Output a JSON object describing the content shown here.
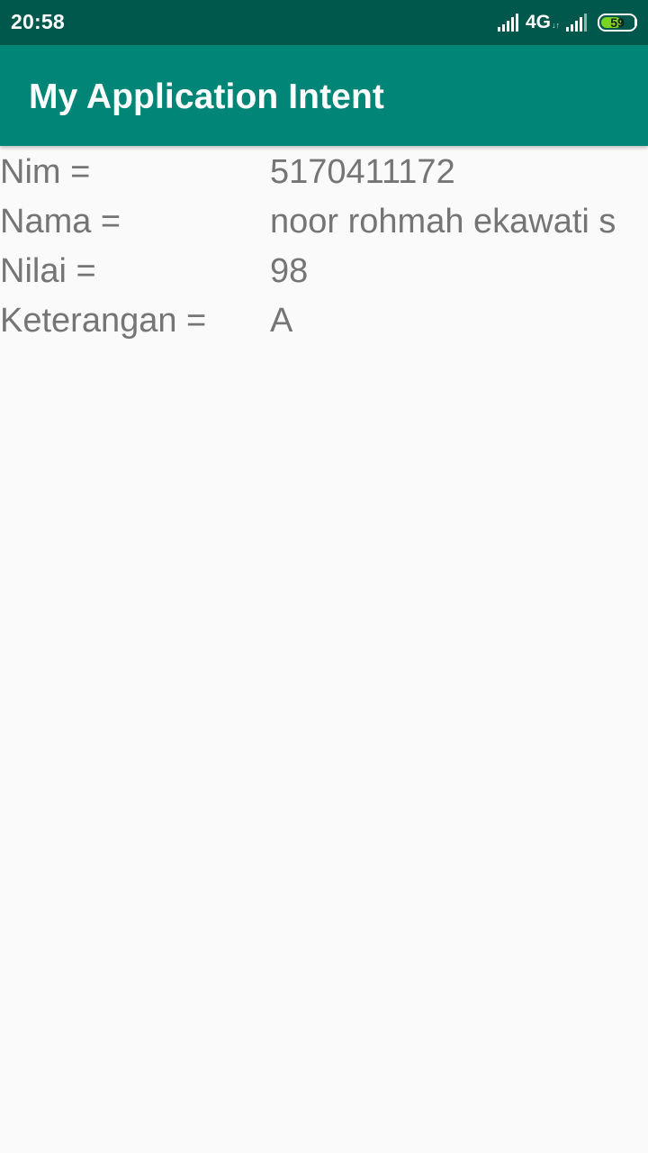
{
  "status_bar": {
    "time": "20:58",
    "network": "4G",
    "network_arrows": "↓↑",
    "battery_level": "59",
    "battery_fill_percent": 59,
    "battery_color": "#7bd321"
  },
  "app_bar": {
    "title": "My Application Intent",
    "color": "#008577"
  },
  "rows": [
    {
      "label": "Nim =",
      "value": "5170411172"
    },
    {
      "label": "Nama =",
      "value": "noor rohmah ekawati s"
    },
    {
      "label": "Nilai =",
      "value": "98"
    },
    {
      "label": "Keterangan =",
      "value": "A"
    }
  ]
}
